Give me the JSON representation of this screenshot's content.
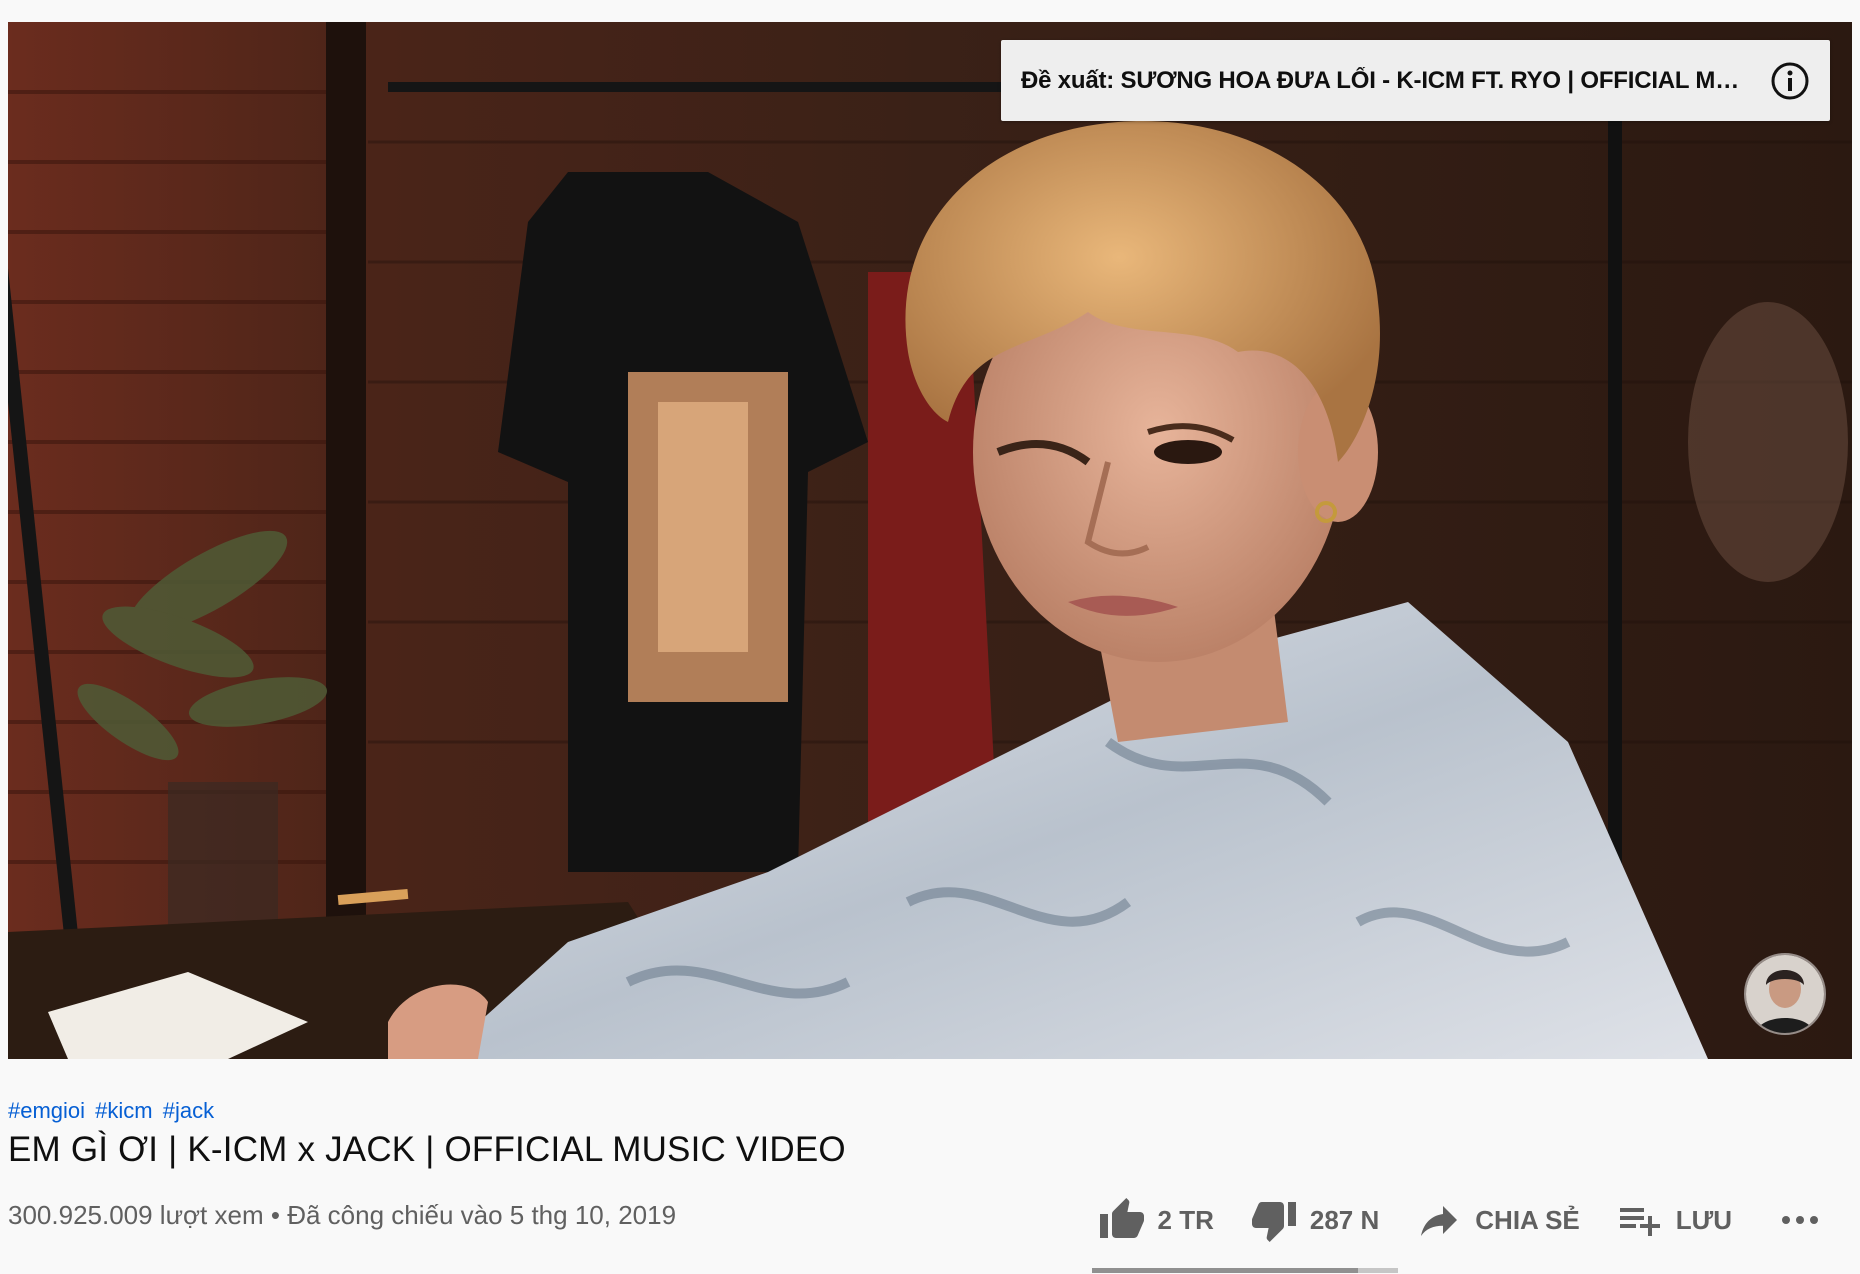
{
  "player": {
    "end_suggestion": {
      "text": "Đề xuất: SƯƠNG HOA ĐƯA LỐI - K-ICM FT. RYO | OFFICIAL MUSIC ...",
      "icon": "info-icon"
    },
    "channel_watermark_icon": "channel-avatar-icon"
  },
  "video": {
    "hashtags": [
      "#emgioi",
      "#kicm",
      "#jack"
    ],
    "title": "EM GÌ ƠI | K-ICM x JACK | OFFICIAL MUSIC VIDEO",
    "views": "300.925.009 lượt xem",
    "separator": "•",
    "date": "Đã công chiếu vào 5 thg 10, 2019"
  },
  "actions": {
    "like_label": "2 TR",
    "dislike_label": "287 N",
    "share_label": "CHIA SẺ",
    "save_label": "LƯU",
    "like_ratio": 0.87
  },
  "colors": {
    "hashtag": "#065fd4",
    "text_primary": "#0f0f0f",
    "text_secondary": "#606060",
    "background": "#f9f9f9"
  }
}
